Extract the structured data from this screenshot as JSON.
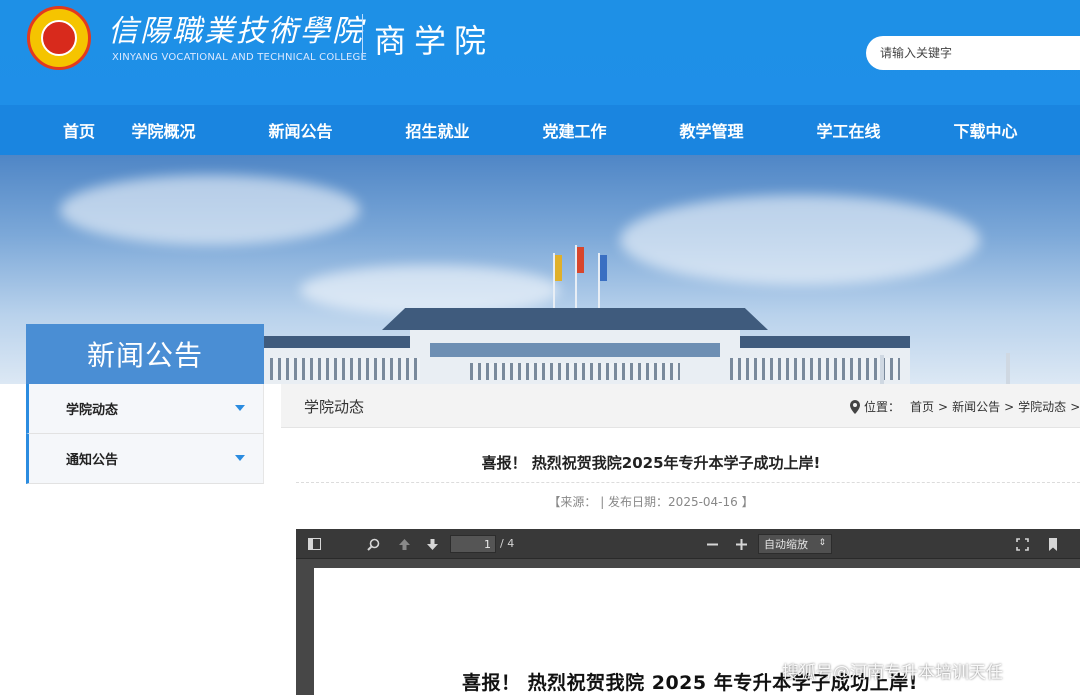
{
  "header": {
    "college_cn": "信陽職業技術學院",
    "college_en": "XINYANG VOCATIONAL AND TECHNICAL COLLEGE",
    "department": "商学院",
    "search_placeholder": "请输入关键字"
  },
  "nav": {
    "items": [
      {
        "label": "首页"
      },
      {
        "label": "学院概况"
      },
      {
        "label": "新闻公告"
      },
      {
        "label": "招生就业"
      },
      {
        "label": "党建工作"
      },
      {
        "label": "教学管理"
      },
      {
        "label": "学工在线"
      },
      {
        "label": "下载中心"
      }
    ]
  },
  "sidebar": {
    "title": "新闻公告",
    "items": [
      {
        "label": "学院动态"
      },
      {
        "label": "通知公告"
      }
    ]
  },
  "content": {
    "section_title": "学院动态",
    "location_label": "位置：",
    "breadcrumb": [
      "首页",
      "新闻公告",
      "学院动态"
    ],
    "breadcrumb_sep": ">",
    "article_title": "喜报！ 热烈祝贺我院2025年专升本学子成功上岸!",
    "meta": "【来源：  | 发布日期：2025-04-16 】"
  },
  "pdf_viewer": {
    "current_page": "1",
    "total_pages": "/ 4",
    "zoom_label": "自动缩放",
    "page_heading": "喜报！  热烈祝贺我院 2025 年专升本学子成功上岸!"
  },
  "watermark": "搜狐号@河南专升本培训天任",
  "colors": {
    "header_blue": "#1e90e6",
    "nav_blue": "#1a85e0",
    "side_title_blue": "#4a8ed4",
    "accent_blue": "#2b8ce0",
    "pdf_toolbar": "#393939"
  }
}
